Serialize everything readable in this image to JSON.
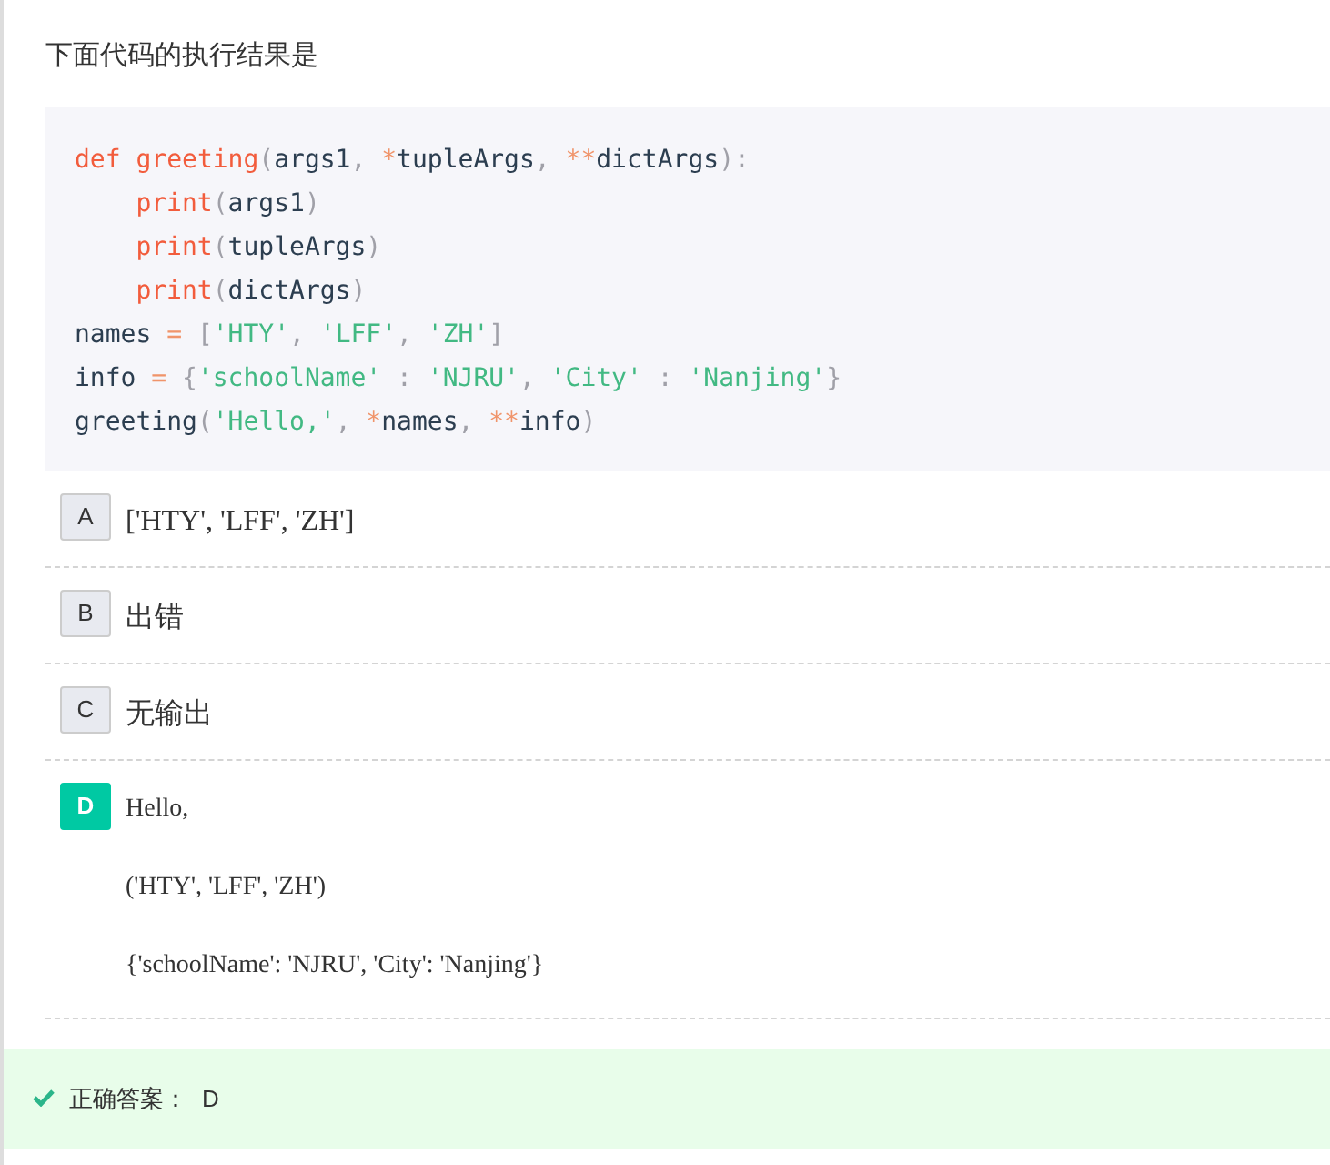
{
  "question": "下面代码的执行结果是",
  "code": [
    {
      "indented": false,
      "tokens": [
        {
          "kind": "kw",
          "text": "def"
        },
        {
          "kind": "kw",
          "text": " greeting"
        },
        {
          "kind": "punc",
          "text": "("
        },
        {
          "kind": "plain",
          "text": "args1"
        },
        {
          "kind": "punc",
          "text": ", "
        },
        {
          "kind": "op",
          "text": "*"
        },
        {
          "kind": "plain",
          "text": "tupleArgs"
        },
        {
          "kind": "punc",
          "text": ", "
        },
        {
          "kind": "op",
          "text": "**"
        },
        {
          "kind": "plain",
          "text": "dictArgs"
        },
        {
          "kind": "punc",
          "text": "):"
        }
      ]
    },
    {
      "indented": true,
      "tokens": [
        {
          "kind": "kw",
          "text": "print"
        },
        {
          "kind": "punc",
          "text": "("
        },
        {
          "kind": "plain",
          "text": "args1"
        },
        {
          "kind": "punc",
          "text": ")"
        }
      ]
    },
    {
      "indented": true,
      "tokens": [
        {
          "kind": "kw",
          "text": "print"
        },
        {
          "kind": "punc",
          "text": "("
        },
        {
          "kind": "plain",
          "text": "tupleArgs"
        },
        {
          "kind": "punc",
          "text": ")"
        }
      ]
    },
    {
      "indented": true,
      "tokens": [
        {
          "kind": "kw",
          "text": "print"
        },
        {
          "kind": "punc",
          "text": "("
        },
        {
          "kind": "plain",
          "text": "dictArgs"
        },
        {
          "kind": "punc",
          "text": ")"
        }
      ]
    },
    {
      "indented": false,
      "tokens": [
        {
          "kind": "plain",
          "text": "names "
        },
        {
          "kind": "op",
          "text": "="
        },
        {
          "kind": "punc",
          "text": " ["
        },
        {
          "kind": "str",
          "text": "'HTY'"
        },
        {
          "kind": "punc",
          "text": ", "
        },
        {
          "kind": "str",
          "text": "'LFF'"
        },
        {
          "kind": "punc",
          "text": ", "
        },
        {
          "kind": "str",
          "text": "'ZH'"
        },
        {
          "kind": "punc",
          "text": "]"
        }
      ]
    },
    {
      "indented": false,
      "tokens": [
        {
          "kind": "plain",
          "text": "info "
        },
        {
          "kind": "op",
          "text": "="
        },
        {
          "kind": "punc",
          "text": " {"
        },
        {
          "kind": "str",
          "text": "'schoolName'"
        },
        {
          "kind": "punc",
          "text": " : "
        },
        {
          "kind": "str",
          "text": "'NJRU'"
        },
        {
          "kind": "punc",
          "text": ", "
        },
        {
          "kind": "str",
          "text": "'City'"
        },
        {
          "kind": "punc",
          "text": " : "
        },
        {
          "kind": "str",
          "text": "'Nanjing'"
        },
        {
          "kind": "punc",
          "text": "}"
        }
      ]
    },
    {
      "indented": false,
      "tokens": [
        {
          "kind": "plain",
          "text": "greeting"
        },
        {
          "kind": "punc",
          "text": "("
        },
        {
          "kind": "str",
          "text": "'Hello,'"
        },
        {
          "kind": "punc",
          "text": ", "
        },
        {
          "kind": "op",
          "text": "*"
        },
        {
          "kind": "plain",
          "text": "names"
        },
        {
          "kind": "punc",
          "text": ", "
        },
        {
          "kind": "op",
          "text": "**"
        },
        {
          "kind": "plain",
          "text": "info"
        },
        {
          "kind": "punc",
          "text": ")"
        }
      ]
    }
  ],
  "options": [
    {
      "letter": "A",
      "selected": false,
      "lines": [
        "['HTY', 'LFF', 'ZH']"
      ]
    },
    {
      "letter": "B",
      "selected": false,
      "lines": [
        "出错"
      ]
    },
    {
      "letter": "C",
      "selected": false,
      "lines": [
        "无输出"
      ]
    },
    {
      "letter": "D",
      "selected": true,
      "lines": [
        "Hello,",
        "('HTY', 'LFF', 'ZH')",
        "{'schoolName': 'NJRU', 'City': 'Nanjing'}"
      ]
    }
  ],
  "answer": {
    "label": "正确答案：",
    "value": "D"
  }
}
